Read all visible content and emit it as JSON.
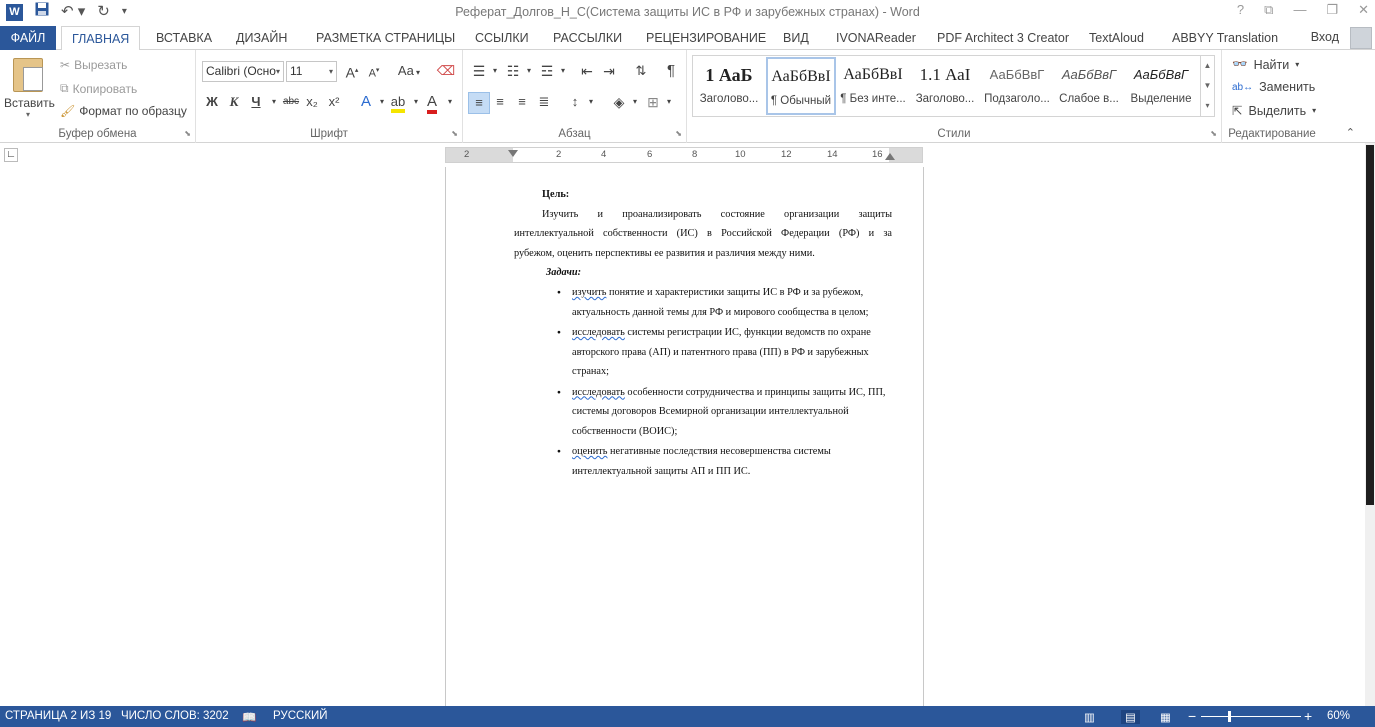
{
  "window": {
    "title": "Реферат_Долгов_Н_С(Система защиты ИС в РФ и зарубежных странах) - Word",
    "app_logo": "W",
    "controls": [
      "?",
      "⧉",
      "—",
      "❐",
      "✕"
    ]
  },
  "tabs": [
    "ФАЙЛ",
    "ГЛАВНАЯ",
    "ВСТАВКА",
    "ДИЗАЙН",
    "РАЗМЕТКА СТРАНИЦЫ",
    "ССЫЛКИ",
    "РАССЫЛКИ",
    "РЕЦЕНЗИРОВАНИЕ",
    "ВИД",
    "IVONAReader",
    "PDF Architect 3 Creator",
    "TextAloud",
    "ABBYY Translation"
  ],
  "active_tab": "ГЛАВНАЯ",
  "signin": "Вход",
  "clipboard": {
    "paste": "Вставить",
    "cut": "Вырезать",
    "copy": "Копировать",
    "format_painter": "Формат по образцу",
    "label": "Буфер обмена"
  },
  "font": {
    "family": "Calibri (Осно",
    "size": "11",
    "bold": "Ж",
    "italic": "К",
    "underline": "Ч",
    "strike": "abc",
    "subscript": "x₂",
    "superscript": "x²",
    "change_case": "Aa",
    "grow": "A",
    "shrink": "A",
    "label": "Шрифт"
  },
  "paragraph": {
    "label": "Абзац",
    "pilcrow": "¶"
  },
  "styles": {
    "items": [
      {
        "preview": "1  АаБ",
        "name": "Заголово..."
      },
      {
        "preview": "АаБбВвI",
        "name": "¶ Обычный"
      },
      {
        "preview": "АаБбВвI",
        "name": "¶ Без инте..."
      },
      {
        "preview": "1.1  АаІ",
        "name": "Заголово..."
      },
      {
        "preview": "АаБбВвГ",
        "name": "Подзаголо..."
      },
      {
        "preview": "АаБбВвГ",
        "name": "Слабое в..."
      },
      {
        "preview": "АаБбВвГ",
        "name": "Выделение"
      }
    ],
    "label": "Стили"
  },
  "editing": {
    "find": "Найти",
    "replace": "Заменить",
    "select": "Выделить",
    "label": "Редактирование"
  },
  "ruler": {
    "numbers": [
      "2",
      "2",
      "4",
      "6",
      "8",
      "10",
      "12",
      "14",
      "16"
    ]
  },
  "document": {
    "goal_heading": "Цель:",
    "goal_line1": "Изучить и проанализировать состояние организации защиты",
    "goal_line2": "интеллектуальной собственности (ИС) в Российской Федерации (РФ) и за",
    "goal_line3": "рубежом, оценить перспективы ее развития и различия между ними.",
    "tasks_heading": "Задачи:",
    "tasks": [
      {
        "verb": "изучить",
        "rest": " понятие и характеристики защиты ИС в РФ и за рубежом, актуальность данной темы для РФ и мирового сообщества в целом;"
      },
      {
        "verb": "исследовать",
        "rest": " системы регистрации ИС, функции ведомств по охране авторского права (АП) и патентного права (ПП) в РФ и зарубежных странах;"
      },
      {
        "verb": "исследовать",
        "rest": " особенности сотрудничества и принципы защиты ИС, ПП, системы договоров Всемирной организации интеллектуальной собственности (ВОИС);"
      },
      {
        "verb": "оценить",
        "rest": " негативные последствия несовершенства системы интеллектуальной защиты АП и ПП ИС."
      }
    ]
  },
  "status": {
    "page": "СТРАНИЦА 2 ИЗ 19",
    "words": "ЧИСЛО СЛОВ: 3202",
    "language": "РУССКИЙ",
    "zoom": "60%",
    "zoom_level": 0.6
  },
  "colors": {
    "accent": "#2b579a"
  }
}
